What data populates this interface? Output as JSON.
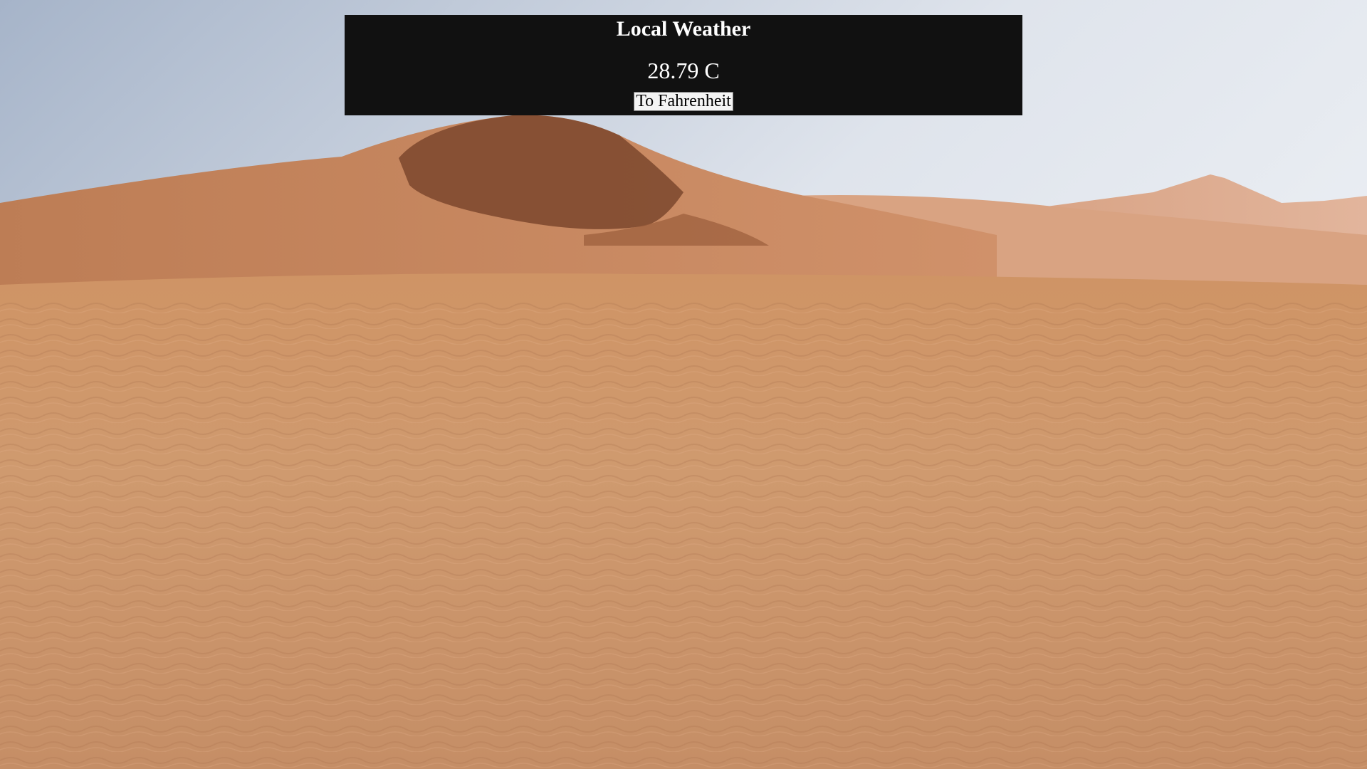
{
  "page": {
    "background": "desert-sand-dunes-photo"
  },
  "panel": {
    "title": "Local Weather",
    "temperature_value": "28.79",
    "temperature_unit": "C",
    "toggle_label": "To Fahrenheit"
  },
  "colors": {
    "panel_background": "#111111",
    "panel_text": "#ffffff",
    "sky_top": "#a9b7cc",
    "sky_bottom": "#e3e8ef",
    "sand": "#d49a6a"
  }
}
